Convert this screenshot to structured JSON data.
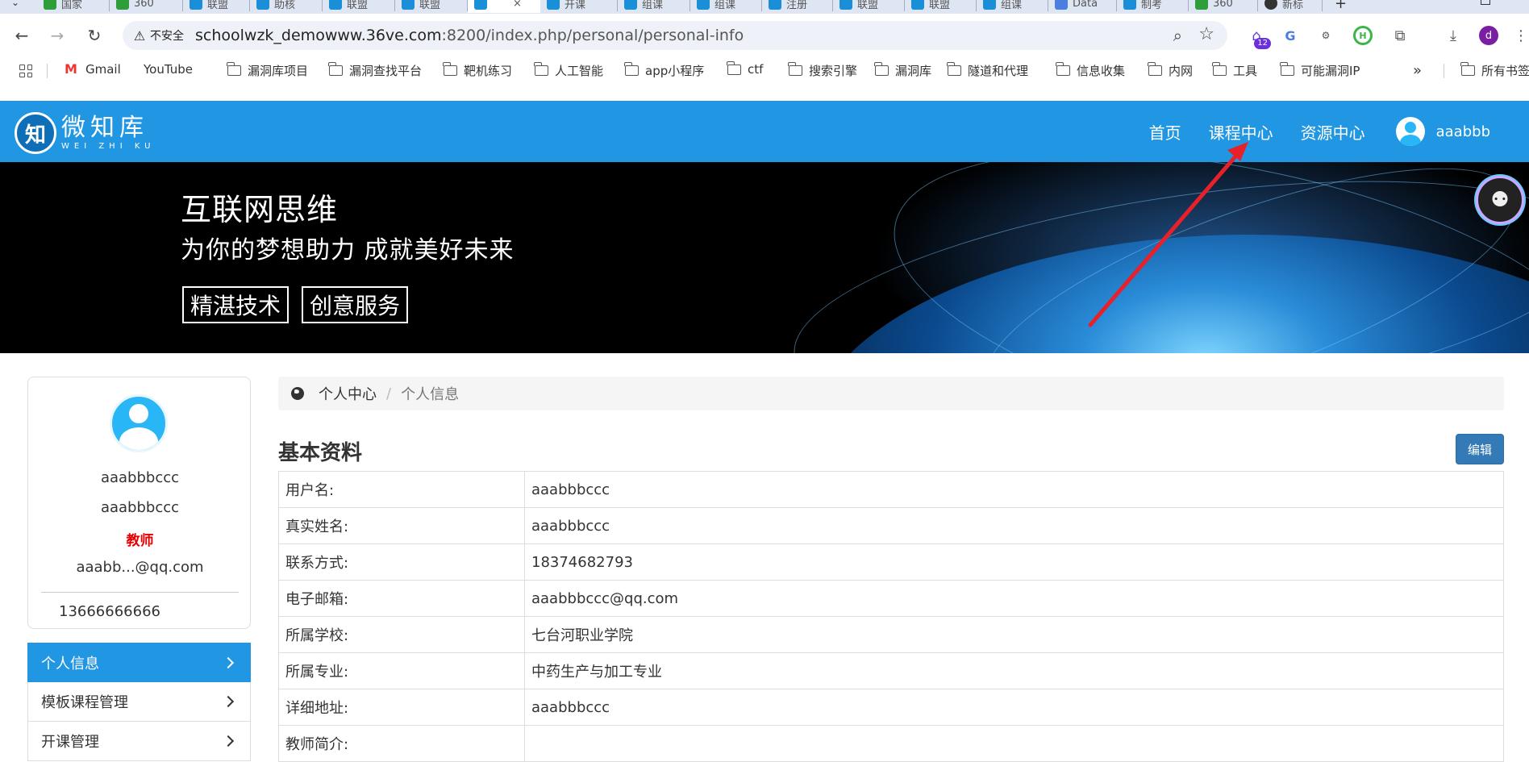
{
  "browser": {
    "tabs": [
      {
        "label": "国家",
        "icon": "chrome-icon"
      },
      {
        "label": "360",
        "icon": "360-icon"
      },
      {
        "label": "联盟",
        "icon": "wzk-icon"
      },
      {
        "label": "助核",
        "icon": "wzk-icon"
      },
      {
        "label": "联盟",
        "icon": "wzk-icon"
      },
      {
        "label": "联盟",
        "icon": "wzk-icon"
      },
      {
        "label": "",
        "icon": "wzk-icon",
        "active": true
      },
      {
        "label": "开课",
        "icon": "wzk-icon"
      },
      {
        "label": "组课",
        "icon": "wzk-icon"
      },
      {
        "label": "组课",
        "icon": "wzk-icon"
      },
      {
        "label": "注册",
        "icon": "wzk-icon"
      },
      {
        "label": "联盟",
        "icon": "wzk-icon"
      },
      {
        "label": "联盟",
        "icon": "wzk-icon"
      },
      {
        "label": "组课",
        "icon": "wzk-icon"
      },
      {
        "label": "Data",
        "icon": "doc-icon"
      },
      {
        "label": "制考",
        "icon": "wzk-icon"
      },
      {
        "label": "360",
        "icon": "360-icon"
      },
      {
        "label": "新标",
        "icon": "github-icon"
      }
    ],
    "security_label": "不安全",
    "url_host": "schoolwzk_demowww.36ve.com",
    "url_path": ":8200/index.php/personal/personal-info",
    "extension_badge": "12",
    "profile_initial": "d",
    "bookmarks": [
      {
        "label": "Gmail",
        "icon": "gmail-icon"
      },
      {
        "label": "YouTube",
        "icon": "youtube-icon"
      },
      {
        "label": "漏洞库项目",
        "icon": "folder-icon"
      },
      {
        "label": "漏洞查找平台",
        "icon": "folder-icon"
      },
      {
        "label": "靶机练习",
        "icon": "folder-icon"
      },
      {
        "label": "人工智能",
        "icon": "folder-icon"
      },
      {
        "label": "app小程序",
        "icon": "folder-icon"
      },
      {
        "label": "ctf",
        "icon": "folder-icon"
      },
      {
        "label": "搜索引擎",
        "icon": "folder-icon"
      },
      {
        "label": "漏洞库",
        "icon": "folder-icon"
      },
      {
        "label": "隧道和代理",
        "icon": "folder-icon"
      },
      {
        "label": "信息收集",
        "icon": "folder-icon"
      },
      {
        "label": "内网",
        "icon": "folder-icon"
      },
      {
        "label": "工具",
        "icon": "folder-icon"
      },
      {
        "label": "可能漏洞IP",
        "icon": "folder-icon"
      }
    ],
    "bookmarks_overflow": "»",
    "all_bookmarks": "所有书签"
  },
  "site": {
    "logo_cn": "微知库",
    "logo_en": "WEI ZHI KU",
    "logo_mark": "知",
    "nav": [
      "首页",
      "课程中心",
      "资源中心"
    ],
    "username": "aaabbb",
    "brand_color": "#2196e3"
  },
  "banner": {
    "title": "互联网思维",
    "subtitle": "为你的梦想助力  成就美好未来",
    "tags": [
      "精湛技术",
      "创意服务"
    ]
  },
  "profile": {
    "username": "aaabbbccc",
    "realname": "aaabbbccc",
    "role": "教师",
    "email": "aaabb...@qq.com",
    "phone": "13666666666"
  },
  "side_menu": [
    {
      "label": "个人信息",
      "active": true
    },
    {
      "label": "模板课程管理",
      "active": false
    },
    {
      "label": "开课管理",
      "active": false
    }
  ],
  "breadcrumb": {
    "home": "个人中心",
    "separator": "/",
    "current": "个人信息"
  },
  "section": {
    "title": "基本资料",
    "edit_label": "编辑"
  },
  "info_rows": [
    {
      "label": "用户名:",
      "value": "aaabbbccc"
    },
    {
      "label": "真实姓名:",
      "value": "aaabbbccc"
    },
    {
      "label": "联系方式:",
      "value": "18374682793"
    },
    {
      "label": "电子邮箱:",
      "value": "aaabbbccc@qq.com"
    },
    {
      "label": "所属学校:",
      "value": "七台河职业学院"
    },
    {
      "label": "所属专业:",
      "value": "中药生产与加工专业"
    },
    {
      "label": "详细地址:",
      "value": "aaabbbccc"
    },
    {
      "label": "教师简介:",
      "value": ""
    }
  ],
  "annotation": {
    "type": "red-arrow",
    "color": "#e8202a",
    "points_to": "课程中心"
  }
}
